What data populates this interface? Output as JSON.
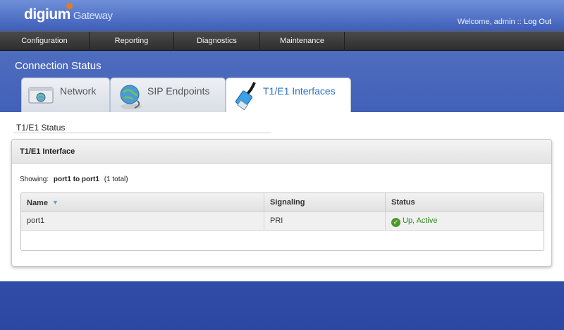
{
  "brand": {
    "name": "digium",
    "product": "Gateway"
  },
  "user": {
    "welcome": "Welcome, admin ::",
    "logout": "Log Out"
  },
  "nav": {
    "items": [
      "Configuration",
      "Reporting",
      "Diagnostics",
      "Maintenance"
    ]
  },
  "page": {
    "title": "Connection Status"
  },
  "tabs": [
    {
      "label": "Network",
      "icon": "network-icon"
    },
    {
      "label": "SIP Endpoints",
      "icon": "sip-globe-icon"
    },
    {
      "label": "T1/E1 Interfaces",
      "icon": "cable-icon",
      "active": true
    }
  ],
  "section": {
    "title": "T1/E1 Status"
  },
  "panel": {
    "title": "T1/E1 Interface",
    "showing_label": "Showing:",
    "showing_range": "port1 to port1",
    "showing_total": "(1 total)"
  },
  "table": {
    "columns": [
      "Name",
      "Signaling",
      "Status"
    ],
    "rows": [
      {
        "name": "port1",
        "signaling": "PRI",
        "status": "Up, Active"
      }
    ]
  },
  "colors": {
    "accent": "#2a6fc9",
    "status_ok": "#2f8a1e",
    "nav_bg": "#333333"
  }
}
